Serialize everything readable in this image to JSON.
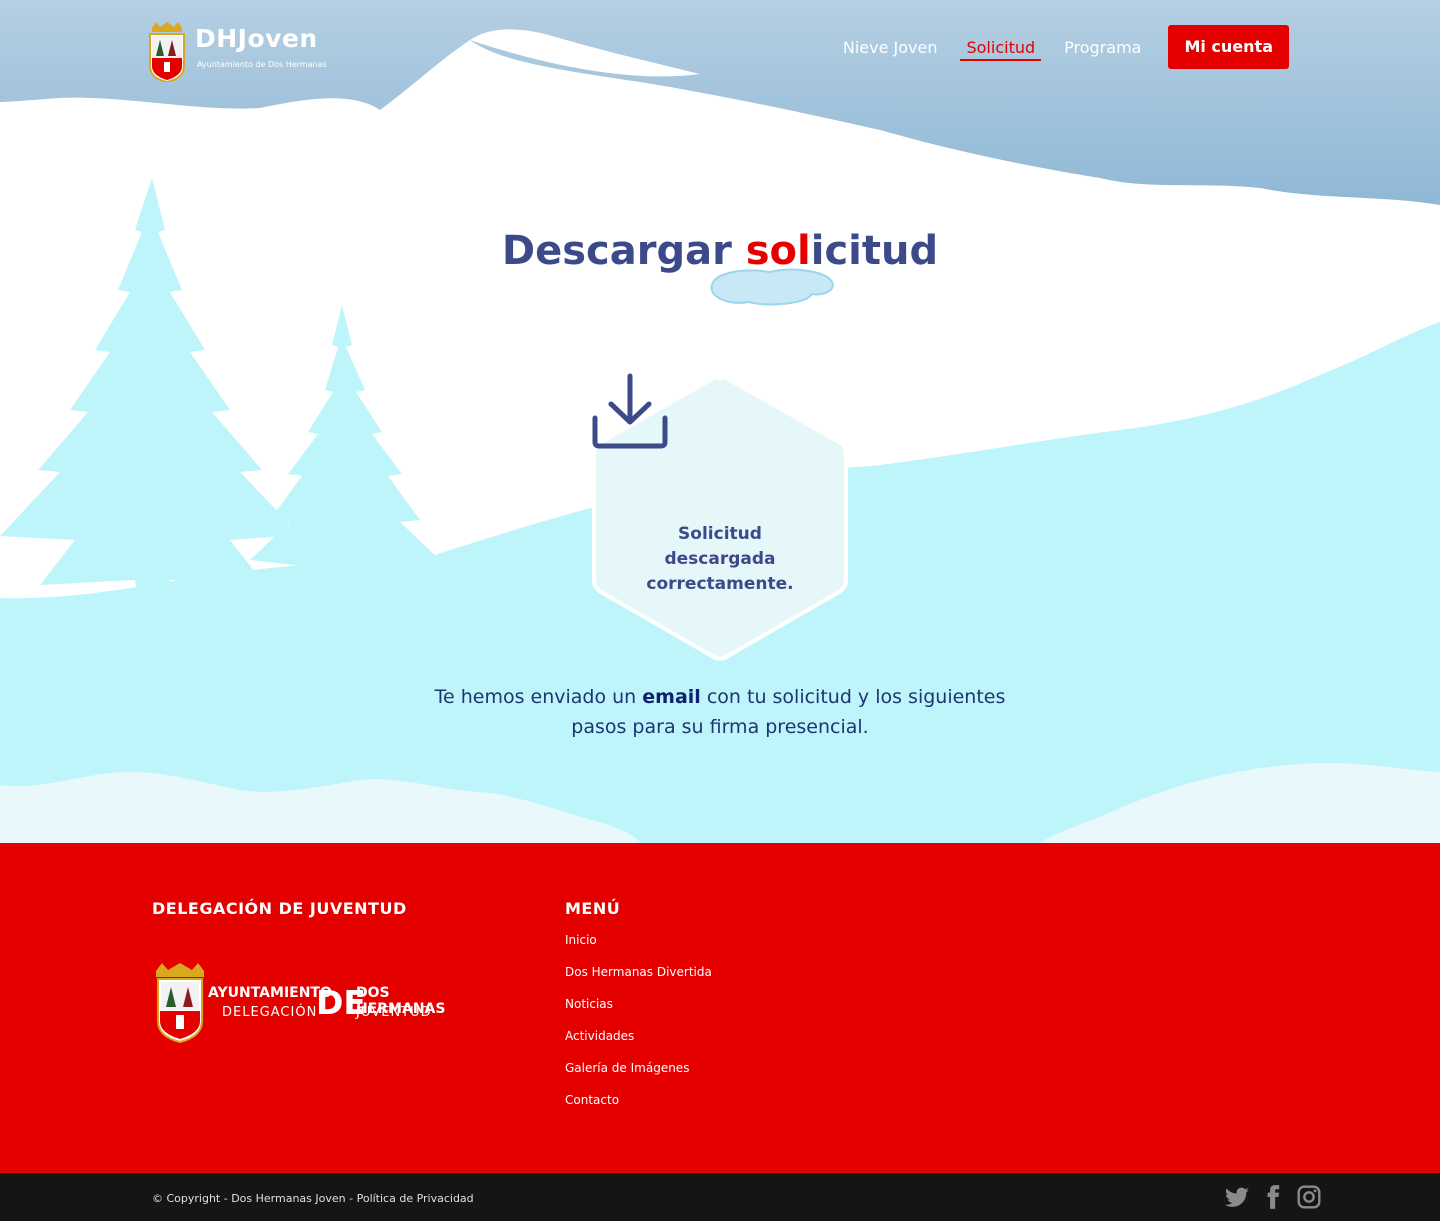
{
  "header": {
    "brand": "DHJoven",
    "brand_sub": "Ayuntamiento de Dos Hermanas",
    "nav": [
      {
        "label": "Nieve Joven",
        "active": false
      },
      {
        "label": "Solicitud",
        "active": true
      },
      {
        "label": "Programa",
        "active": false
      }
    ],
    "account_button": "Mi cuenta"
  },
  "main": {
    "title_start": "Descargar ",
    "title_highlight": "sol",
    "title_end": "icitud",
    "status_line1": "Solicitud",
    "status_line2": "descargada",
    "status_line3": "correctamente.",
    "icon": "download-icon",
    "message_before": "Te hemos enviado un ",
    "message_bold": "email",
    "message_after": " con tu solicitud y los siguientes pasos para su firma presencial."
  },
  "footer": {
    "delegation_title": "DELEGACIÓN DE JUVENTUD",
    "logo": {
      "ayuntamiento": "AYUNTAMIENTO",
      "delegacion": "DELEGACIÓN",
      "de": "DE",
      "dos_hermanas": "DOS HERMANAS",
      "juventud": "JUVENTUD"
    },
    "menu_title": "MENÚ",
    "menu": [
      "Inicio",
      "Dos Hermanas Divertida",
      "Noticias",
      "Actividades",
      "Galería de Imágenes",
      "Contacto"
    ]
  },
  "bottom_bar": {
    "copyright": "© Copyright - Dos Hermanas Joven - ",
    "privacy": "Política de Privacidad",
    "social": [
      "twitter-icon",
      "facebook-icon",
      "instagram-icon"
    ]
  },
  "colors": {
    "brand_red": "#e50000",
    "title_blue": "#3c4a8a",
    "sky_blue": "#a9c8de",
    "ice": "#bdf5fb",
    "footer_bar": "#151515"
  }
}
